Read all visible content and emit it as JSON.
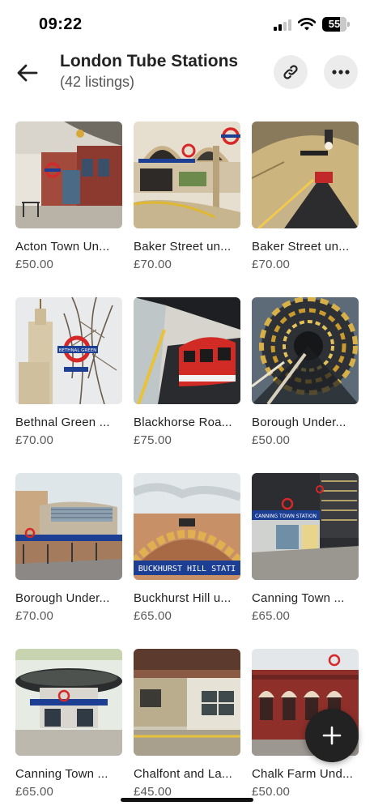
{
  "status_bar": {
    "time": "09:22",
    "battery": "55",
    "icons": [
      "cellular-signal-icon",
      "wifi-icon",
      "battery-icon"
    ]
  },
  "header": {
    "title": "London Tube Stations",
    "subtitle": "(42 listings)",
    "back_icon": "arrow-left-icon",
    "link_icon": "link-icon",
    "more_icon": "more-horizontal-icon"
  },
  "listings": [
    {
      "title": "Acton Town Un...",
      "price": "£50.00"
    },
    {
      "title": "Baker Street un...",
      "price": "£70.00"
    },
    {
      "title": "Baker Street un...",
      "price": "£70.00"
    },
    {
      "title": "Bethnal Green ...",
      "price": "£70.00"
    },
    {
      "title": "Blackhorse Roa...",
      "price": "£75.00"
    },
    {
      "title": "Borough Under...",
      "price": "£50.00"
    },
    {
      "title": "Borough Under...",
      "price": "£70.00"
    },
    {
      "title": "Buckhurst Hill u...",
      "price": "£65.00"
    },
    {
      "title": "Canning Town ...",
      "price": "£65.00"
    },
    {
      "title": "Canning Town ...",
      "price": "£65.00"
    },
    {
      "title": "Chalfont and La...",
      "price": "£45.00"
    },
    {
      "title": "Chalk Farm Und...",
      "price": "£50.00"
    }
  ],
  "painting_signs": {
    "bethnal_green": "BETHNAL GREEN",
    "buckhurst_hill": "BUCKHURST HILL STATI",
    "canning_town": "CANNING TOWN STATION"
  },
  "fab": {
    "icon": "plus-icon"
  },
  "colors": {
    "text_primary": "#222222",
    "text_secondary": "#595959",
    "button_bg": "#ececec",
    "fab_bg": "#222222",
    "tube_red": "#d62828",
    "tube_blue": "#1c3f94"
  }
}
